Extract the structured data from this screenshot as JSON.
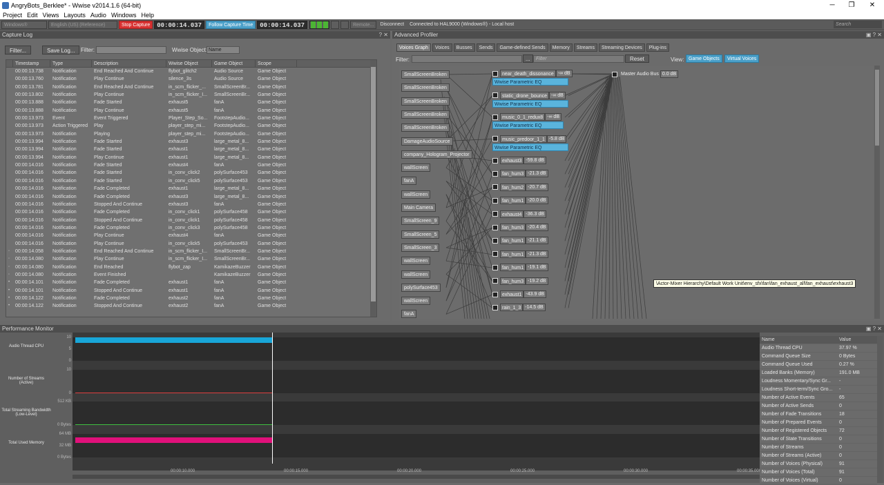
{
  "window": {
    "title": "AngryBots_Berklee* - Wwise v2014.1.6 (64-bit)",
    "min": "─",
    "max": "❐",
    "close": "✕"
  },
  "menu": [
    "Project",
    "Edit",
    "Views",
    "Layouts",
    "Audio",
    "Windows",
    "Help"
  ],
  "toolbar": {
    "platform": "Windows®",
    "language": "English (US) (Reference)",
    "stop_capture": "Stop Capture",
    "capture_time": "00:00:14.037",
    "follow": "Follow Capture Time",
    "time2": "00:00:14.037",
    "remote": "Remote...",
    "disconnect": "Disconnect",
    "status": "Connected to HAL9000 (Windows®) - Local host",
    "search": "Search"
  },
  "capture_log": {
    "title": "Capture Log",
    "pin": "? ✕",
    "filter_btn": "Filter...",
    "save_btn": "Save Log...",
    "filter_label": "Filter:",
    "wwise_object_label": "Wwise Object:",
    "wwise_object_value": "Name",
    "columns": [
      "",
      "Timestamp",
      "Type",
      "Description",
      "Wwise Object",
      "Game Object",
      "Scope"
    ],
    "rows": [
      [
        "",
        "00:00:13.738",
        "Notification",
        "End Reached And Continue",
        "flybot_glitch2",
        "Audio Source",
        "Game Object"
      ],
      [
        "",
        "00:00:13.760",
        "Notification",
        "Play Continue",
        "silence_3s",
        "Audio Source",
        "Game Object"
      ],
      [
        "",
        "00:00:13.781",
        "Notification",
        "End Reached And Continue",
        "in_scm_flicker_...",
        "SmallScreenBr...",
        "Game Object"
      ],
      [
        "",
        "00:00:13.802",
        "Notification",
        "Play Continue",
        "in_scm_flicker_I...",
        "SmallScreenBr...",
        "Game Object"
      ],
      [
        "",
        "00:00:13.888",
        "Notification",
        "Fade Started",
        "exhaust5",
        "fanA",
        "Game Object"
      ],
      [
        "",
        "00:00:13.888",
        "Notification",
        "Play Continue",
        "exhaust5",
        "fanA",
        "Game Object"
      ],
      [
        "",
        "00:00:13.973",
        "Event",
        "Event Triggered",
        "Player_Step_So...",
        "FootstepAudio...",
        "Game Object"
      ],
      [
        "",
        "00:00:13.973",
        "Action Triggered",
        "Play",
        "player_step_mi...",
        "FootstepAudio...",
        "Game Object"
      ],
      [
        "",
        "00:00:13.973",
        "Notification",
        "Playing",
        "player_step_mi...",
        "FootstepAudio...",
        "Game Object"
      ],
      [
        "",
        "00:00:13.994",
        "Notification",
        "Fade Started",
        "exhaust3",
        "large_metal_8...",
        "Game Object"
      ],
      [
        "",
        "00:00:13.994",
        "Notification",
        "Fade Started",
        "exhaust1",
        "large_metal_8...",
        "Game Object"
      ],
      [
        "",
        "00:00:13.994",
        "Notification",
        "Play Continue",
        "exhaust1",
        "large_metal_8...",
        "Game Object"
      ],
      [
        "",
        "00:00:14.016",
        "Notification",
        "Fade Started",
        "exhaust4",
        "fanA",
        "Game Object"
      ],
      [
        "",
        "00:00:14.016",
        "Notification",
        "Fade Started",
        "in_conv_click2",
        "polySurface453",
        "Game Object"
      ],
      [
        "",
        "00:00:14.016",
        "Notification",
        "Fade Started",
        "in_conv_click5",
        "polySurface453",
        "Game Object"
      ],
      [
        "",
        "00:00:14.016",
        "Notification",
        "Fade Completed",
        "exhaust1",
        "large_metal_8...",
        "Game Object"
      ],
      [
        "",
        "00:00:14.016",
        "Notification",
        "Fade Completed",
        "exhaust3",
        "large_metal_8...",
        "Game Object"
      ],
      [
        "",
        "00:00:14.016",
        "Notification",
        "Stopped And Continue",
        "exhaust3",
        "fanA",
        "Game Object"
      ],
      [
        "",
        "00:00:14.016",
        "Notification",
        "Fade Completed",
        "in_conv_click1",
        "polySurface458",
        "Game Object"
      ],
      [
        "",
        "00:00:14.016",
        "Notification",
        "Stopped And Continue",
        "in_conv_click1",
        "polySurface458",
        "Game Object"
      ],
      [
        "",
        "00:00:14.016",
        "Notification",
        "Fade Completed",
        "in_conv_click3",
        "polySurface458",
        "Game Object"
      ],
      [
        "",
        "00:00:14.016",
        "Notification",
        "Play Continue",
        "exhaust4",
        "fanA",
        "Game Object"
      ],
      [
        "",
        "00:00:14.016",
        "Notification",
        "Play Continue",
        "in_conv_click5",
        "polySurface453",
        "Game Object"
      ],
      [
        "◦",
        "00:00:14.058",
        "Notification",
        "End Reached And Continue",
        "in_scm_flicker_I...",
        "SmallScreenBr...",
        "Game Object"
      ],
      [
        "◦",
        "00:00:14.080",
        "Notification",
        "Play Continue",
        "in_scm_flicker_I...",
        "SmallScreenBr...",
        "Game Object"
      ],
      [
        "◦",
        "00:00:14.080",
        "Notification",
        "End Reached",
        "flybot_zap",
        "KamikazeBuzzer",
        "Game Object"
      ],
      [
        "◦",
        "00:00:14.080",
        "Notification",
        "Event Finished",
        "",
        "KamikazeBuzzer",
        "Game Object"
      ],
      [
        "•",
        "00:00:14.101",
        "Notification",
        "Fade Completed",
        "exhaust1",
        "fanA",
        "Game Object"
      ],
      [
        "•",
        "00:00:14.101",
        "Notification",
        "Stopped And Continue",
        "exhaust1",
        "fanA",
        "Game Object"
      ],
      [
        "•",
        "00:00:14.122",
        "Notification",
        "Fade Completed",
        "exhaust2",
        "fanA",
        "Game Object"
      ],
      [
        "•",
        "00:00:14.122",
        "Notification",
        "Stopped And Continue",
        "exhaust2",
        "fanA",
        "Game Object"
      ]
    ]
  },
  "profiler": {
    "title": "Advanced Profiler",
    "pin": "▣ ? ✕",
    "tabs": [
      "Voices Graph",
      "Voices",
      "Busses",
      "Sends",
      "Game-defined Sends",
      "Memory",
      "Streams",
      "Streaming Devices",
      "Plug-ins"
    ],
    "filter_label": "Filter:",
    "filter_browse": "...",
    "filter_placeholder": "Filter",
    "reset": "Reset",
    "view_label": "View:",
    "view_game_objects": "Game Objects",
    "view_virtual_voices": "Virtual Voices",
    "game_objects": [
      "SmallScreenBroken",
      "SmallScreenBroken",
      "SmallScreenBroken",
      "SmallScreenBroken",
      "SmallScreenBroken",
      "DamageAudioSource",
      "company_Hologram_Projector",
      "wallScreen",
      "fanA",
      "wallScreen",
      "Main Camera",
      "SmallScreen_9",
      "SmallScreen_5",
      "SmallScreen_3",
      "wallScreen",
      "wallScreen",
      "polySurface453",
      "wallScreen",
      "fanA"
    ],
    "voices": [
      {
        "name": "near_death_dissonance",
        "db": "-∞ dB",
        "eq": "Wwise Parametric EQ"
      },
      {
        "name": "static_drone_bounce",
        "db": "-∞ dB",
        "eq": "Wwise Parametric EQ"
      },
      {
        "name": "music_0_1_redux8",
        "db": "-∞ dB",
        "eq": "Wwise Parametric EQ"
      },
      {
        "name": "music_predoor_1_1",
        "db": "-5.8 dB",
        "eq": "Wwise Parametric EQ"
      },
      {
        "name": "exhaust3",
        "db": "-59.8 dB"
      },
      {
        "name": "fan_hum3",
        "db": "-21.3 dB"
      },
      {
        "name": "fan_hum2",
        "db": "-20.7 dB"
      },
      {
        "name": "fan_hum1",
        "db": "-20.0 dB"
      },
      {
        "name": "exhaust4",
        "db": "-36.3 dB"
      },
      {
        "name": "fan_hum3",
        "db": "-20.4 dB"
      },
      {
        "name": "fan_hum1",
        "db": "-21.1 dB"
      },
      {
        "name": "fan_hum1",
        "db": "-21.3 dB"
      },
      {
        "name": "fan_hum1",
        "db": "-19.1 dB"
      },
      {
        "name": "fan_hum3",
        "db": "-19.2 dB"
      },
      {
        "name": "exhaust1",
        "db": "-43.9 dB"
      },
      {
        "name": "rain_1_3",
        "db": "-14.5 dB"
      }
    ],
    "master_bus": {
      "name": "Master Audio Bus",
      "db": "0.0 dB"
    },
    "tooltip": "\\Actor-Mixer Hierarchy\\Default Work Unit\\env_sfx\\fan\\fan_exhaust_all\\fan_exhaust\\exhaust3"
  },
  "performance": {
    "title": "Performance Monitor",
    "pin": "▣ ? ✕",
    "rows": [
      {
        "label": "Audio Thread CPU",
        "ticks": [
          "10",
          "5",
          "0"
        ],
        "color": "#18a6d8",
        "level": 1.0
      },
      {
        "label": "Number of Streams (Active)",
        "ticks": [
          "10",
          "0"
        ],
        "color": "#e04040",
        "level": 0.0
      },
      {
        "label": "Total Streaming Bandwidth (Low-Level)",
        "ticks": [
          "512 KB",
          "0 Bytes"
        ],
        "color": "#3ec040",
        "level": 0.0
      },
      {
        "label": "Total Used Memory",
        "ticks": [
          "64 MB",
          "32 MB",
          "0 Bytes"
        ],
        "color": "#e0107a",
        "level": 0.85
      }
    ],
    "time_ticks": [
      "00:00:10.000",
      "00:00:15.000",
      "00:00:20.000",
      "00:00:25.000",
      "00:00:30.000",
      "00:00:35.000"
    ],
    "cursor_fraction": 0.29,
    "props_header": [
      "Name",
      "Value"
    ],
    "props": [
      [
        "Audio Thread CPU",
        "37.97 %"
      ],
      [
        "Command Queue Size",
        "0 Bytes"
      ],
      [
        "Command Queue Used",
        "0.27 %"
      ],
      [
        "Loaded Banks (Memory)",
        "191.0 MB"
      ],
      [
        "Loudness Momentary/Sync Gr...",
        "-"
      ],
      [
        "Loudness Short-term/Sync Gro...",
        "-"
      ],
      [
        "Number of Active Events",
        "65"
      ],
      [
        "Number of Active Sends",
        "0"
      ],
      [
        "Number of Fade Transitions",
        "18"
      ],
      [
        "Number of Prepared Events",
        "0"
      ],
      [
        "Number of Registered Objects",
        "72"
      ],
      [
        "Number of State Transitions",
        "0"
      ],
      [
        "Number of Streams",
        "0"
      ],
      [
        "Number of Streams (Active)",
        "0"
      ],
      [
        "Number of Voices (Physical)",
        "91"
      ],
      [
        "Number of Voices (Total)",
        "91"
      ],
      [
        "Number of Voices (Virtual)",
        "0"
      ]
    ]
  }
}
